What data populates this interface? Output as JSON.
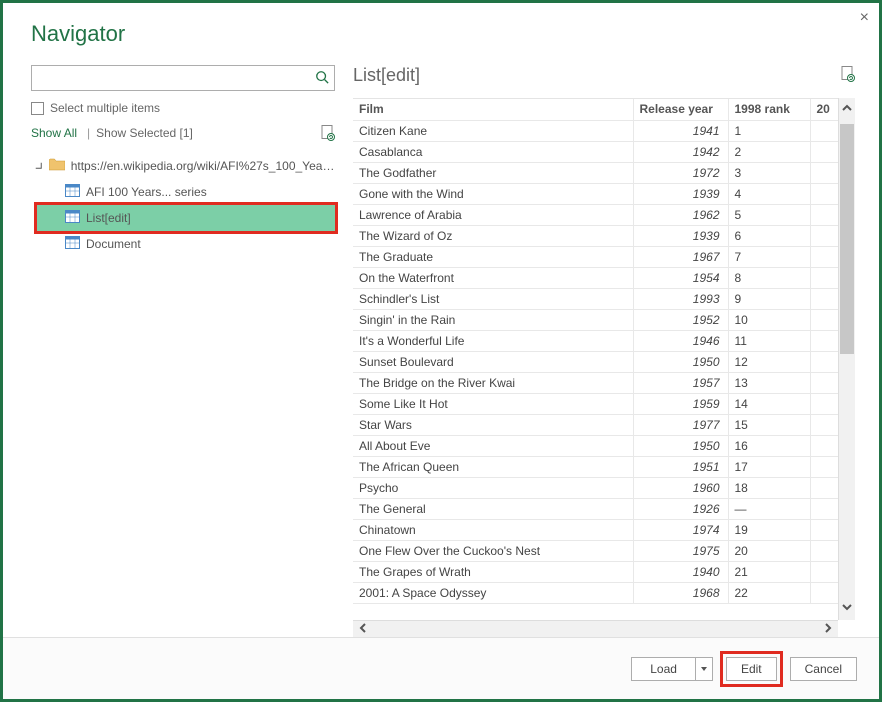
{
  "title": "Navigator",
  "search": {
    "placeholder": ""
  },
  "select_multiple_label": "Select multiple items",
  "show_all_label": "Show All",
  "show_selected_label": "Show Selected [1]",
  "tree": {
    "root_label": "https://en.wikipedia.org/wiki/AFI%27s_100_Years...",
    "items": [
      {
        "label": "AFI 100 Years... series"
      },
      {
        "label": "List[edit]"
      },
      {
        "label": "Document"
      }
    ]
  },
  "preview_title": "List[edit]",
  "columns": {
    "film": "Film",
    "year": "Release year",
    "rank98": "1998 rank",
    "rank20_partial": "20"
  },
  "rows": [
    {
      "film": "Citizen Kane",
      "year": "1941",
      "rank": "1"
    },
    {
      "film": "Casablanca",
      "year": "1942",
      "rank": "2"
    },
    {
      "film": "The Godfather",
      "year": "1972",
      "rank": "3"
    },
    {
      "film": "Gone with the Wind",
      "year": "1939",
      "rank": "4"
    },
    {
      "film": "Lawrence of Arabia",
      "year": "1962",
      "rank": "5"
    },
    {
      "film": "The Wizard of Oz",
      "year": "1939",
      "rank": "6"
    },
    {
      "film": "The Graduate",
      "year": "1967",
      "rank": "7"
    },
    {
      "film": "On the Waterfront",
      "year": "1954",
      "rank": "8"
    },
    {
      "film": "Schindler's List",
      "year": "1993",
      "rank": "9"
    },
    {
      "film": "Singin' in the Rain",
      "year": "1952",
      "rank": "10"
    },
    {
      "film": "It's a Wonderful Life",
      "year": "1946",
      "rank": "11"
    },
    {
      "film": "Sunset Boulevard",
      "year": "1950",
      "rank": "12"
    },
    {
      "film": "The Bridge on the River Kwai",
      "year": "1957",
      "rank": "13"
    },
    {
      "film": "Some Like It Hot",
      "year": "1959",
      "rank": "14"
    },
    {
      "film": "Star Wars",
      "year": "1977",
      "rank": "15"
    },
    {
      "film": "All About Eve",
      "year": "1950",
      "rank": "16"
    },
    {
      "film": "The African Queen",
      "year": "1951",
      "rank": "17"
    },
    {
      "film": "Psycho",
      "year": "1960",
      "rank": "18"
    },
    {
      "film": "The General",
      "year": "1926",
      "rank": "—"
    },
    {
      "film": "Chinatown",
      "year": "1974",
      "rank": "19"
    },
    {
      "film": "One Flew Over the Cuckoo's Nest",
      "year": "1975",
      "rank": "20"
    },
    {
      "film": "The Grapes of Wrath",
      "year": "1940",
      "rank": "21"
    },
    {
      "film": "2001: A Space Odyssey",
      "year": "1968",
      "rank": "22"
    }
  ],
  "buttons": {
    "load": "Load",
    "edit": "Edit",
    "cancel": "Cancel"
  }
}
